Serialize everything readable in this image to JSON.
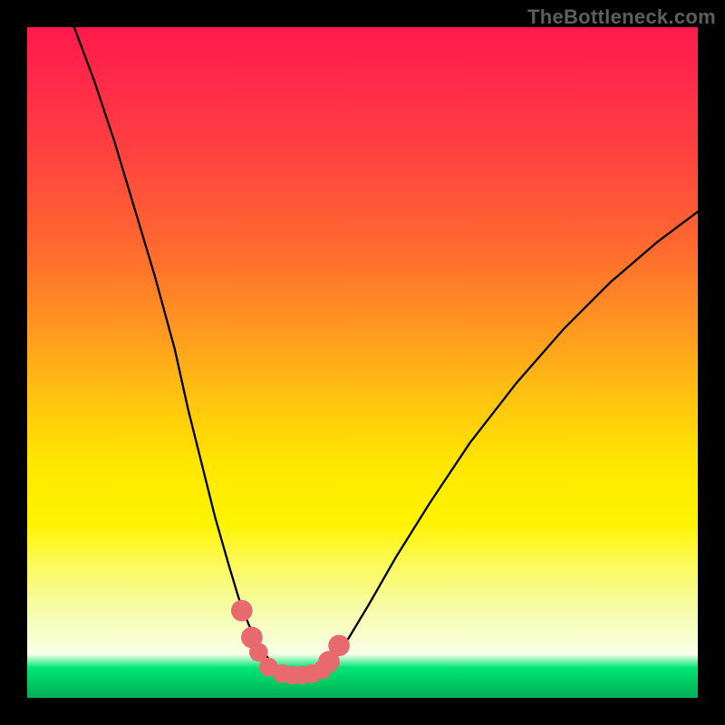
{
  "watermark": {
    "text": "TheBottleneck.com"
  },
  "chart_data": {
    "type": "line",
    "title": "",
    "xlabel": "",
    "ylabel": "",
    "xlim": [
      0,
      100
    ],
    "ylim": [
      0,
      100
    ],
    "series": [
      {
        "name": "left-curve",
        "x": [
          7,
          10,
          13,
          16,
          19,
          22,
          24,
          26,
          28,
          30,
          31.5,
          33,
          34.5,
          36,
          37.5
        ],
        "values": [
          100,
          92,
          83,
          73,
          63,
          52,
          43,
          35,
          27,
          20,
          15,
          11,
          8,
          5.8,
          4.2
        ]
      },
      {
        "name": "right-curve",
        "x": [
          44.5,
          46,
          48,
          51,
          55,
          60,
          66,
          73,
          80,
          87,
          94,
          100
        ],
        "values": [
          4.5,
          6.2,
          9,
          14,
          21,
          29,
          38,
          47,
          55,
          62,
          68,
          72.5
        ]
      }
    ],
    "markers": {
      "name": "highlight-dots",
      "color": "#e96a6e",
      "points": [
        {
          "x": 32.0,
          "y": 13.0,
          "r": 1.6
        },
        {
          "x": 33.5,
          "y": 9.0,
          "r": 1.6
        },
        {
          "x": 34.5,
          "y": 6.8,
          "r": 1.4
        },
        {
          "x": 36.0,
          "y": 4.6,
          "r": 1.4
        },
        {
          "x": 38.0,
          "y": 3.6,
          "r": 1.4
        },
        {
          "x": 39.5,
          "y": 3.4,
          "r": 1.4
        },
        {
          "x": 41.0,
          "y": 3.4,
          "r": 1.4
        },
        {
          "x": 42.5,
          "y": 3.6,
          "r": 1.4
        },
        {
          "x": 44.0,
          "y": 4.2,
          "r": 1.4
        },
        {
          "x": 45.0,
          "y": 5.4,
          "r": 1.6
        },
        {
          "x": 46.5,
          "y": 7.8,
          "r": 1.6
        }
      ]
    }
  }
}
